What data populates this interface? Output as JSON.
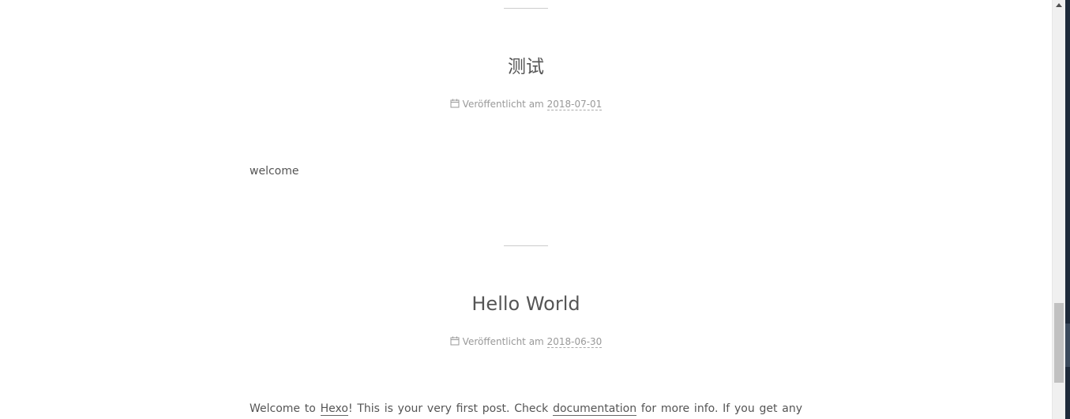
{
  "posts": [
    {
      "title": "测试",
      "meta_label": "Veröffentlicht am",
      "date": "2018-07-01",
      "body": "welcome"
    },
    {
      "title": "Hello World",
      "meta_label": "Veröffentlicht am",
      "date": "2018-06-30",
      "body_parts": {
        "t1": "Welcome to ",
        "link1": "Hexo",
        "t2": "! This is your very first post. Check ",
        "link2": "documentation",
        "t3": " for more info. If you get any"
      }
    }
  ],
  "icons": {
    "calendar": "calendar-icon",
    "scroll_up": "arrow-up-icon"
  }
}
